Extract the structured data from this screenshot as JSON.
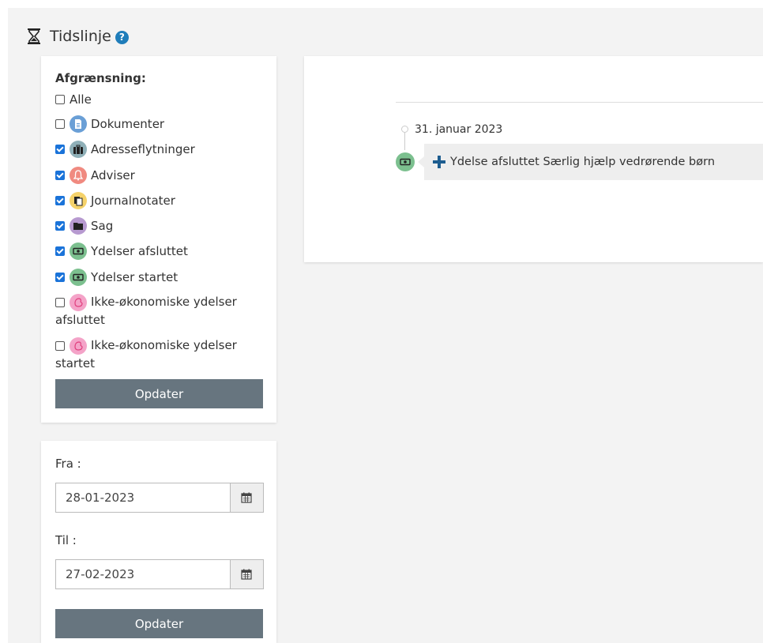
{
  "header": {
    "title": "Tidslinje",
    "help_icon": "question-circle-icon"
  },
  "filter": {
    "title": "Afgrænsning:",
    "items": [
      {
        "label": "Alle",
        "checked": false,
        "icon": null
      },
      {
        "label": "Dokumenter",
        "checked": false,
        "icon": "document-icon",
        "icon_color": "#6a9fd6"
      },
      {
        "label": "Adresseflytninger",
        "checked": true,
        "icon": "suitcase-icon",
        "icon_color": "#8fb0b8"
      },
      {
        "label": "Adviser",
        "checked": true,
        "icon": "bell-icon",
        "icon_color": "#f08a80"
      },
      {
        "label": "Journalnotater",
        "checked": true,
        "icon": "notes-icon",
        "icon_color": "#f5d26a"
      },
      {
        "label": "Sag",
        "checked": true,
        "icon": "folder-icon",
        "icon_color": "#b79ad0"
      },
      {
        "label": "Ydelser afsluttet",
        "checked": true,
        "icon": "money-icon",
        "icon_color": "#7cc08f"
      },
      {
        "label": "Ydelser startet",
        "checked": true,
        "icon": "money-icon",
        "icon_color": "#7cc08f"
      },
      {
        "label": "Ikke-økonomiske ydelser afsluttet",
        "checked": false,
        "icon": "hand-icon",
        "icon_color": "#f4a3c8"
      },
      {
        "label": "Ikke-økonomiske ydelser startet",
        "checked": false,
        "icon": "hand-icon",
        "icon_color": "#f4a3c8"
      }
    ],
    "update_label": "Opdater"
  },
  "dates": {
    "from_label": "Fra :",
    "from_value": "28-01-2023",
    "to_label": "Til :",
    "to_value": "27-02-2023",
    "update_label": "Opdater"
  },
  "timeline": {
    "date": "31. januar 2023",
    "event_text": "Ydelse afsluttet Særlig hjælp vedrørende børn",
    "event_icon": "money-icon"
  },
  "colors": {
    "button": "#67757f",
    "accent": "#1a73d9",
    "plus": "#1d5d8f"
  }
}
